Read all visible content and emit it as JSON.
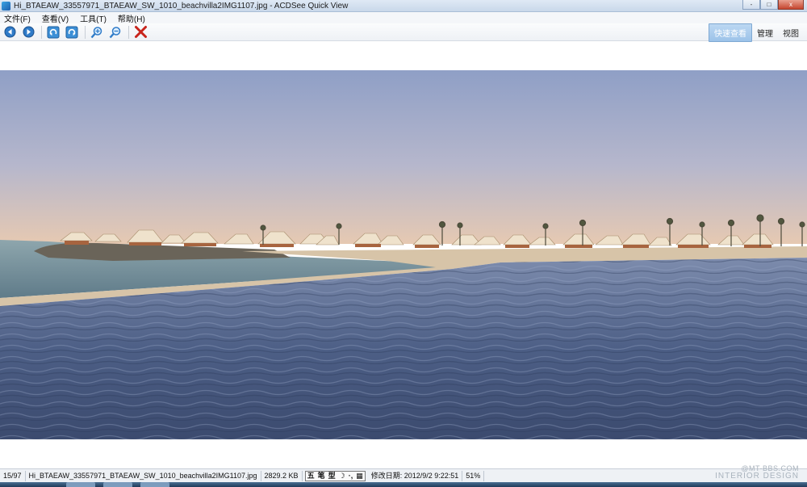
{
  "window": {
    "title": "Hi_BTAEAW_33557971_BTAEAW_SW_1010_beachvilla2IMG1107.jpg - ACDSee Quick View",
    "controls": [
      "-",
      "□",
      "x"
    ]
  },
  "menu": {
    "items": [
      "文件(F)",
      "查看(V)",
      "工具(T)",
      "帮助(H)"
    ]
  },
  "toolbar": {
    "buttons": [
      "back-icon",
      "forward-icon",
      "rotate-left-icon",
      "rotate-right-icon",
      "zoom-in-icon",
      "zoom-out-icon",
      "delete-icon"
    ],
    "tabs": [
      "快速查看",
      "管理",
      "视图"
    ]
  },
  "status": {
    "position": "15/97",
    "filename": "Hi_BTAEAW_33557971_BTAEAW_SW_1010_beachvilla2IMG1107.jpg",
    "size": "2829.2 KB",
    "ime_chars": [
      "五",
      "笔",
      "型"
    ],
    "modified": "修改日期: 2012/9/2 9:22:51",
    "zoom": "51%"
  },
  "watermark": {
    "line1": "@MT-BBS.COM",
    "line2": "INTERIOR DESIGN"
  },
  "colors": {
    "accent": "#9cc3e9",
    "delete": "#c8241b",
    "nav": "#2f7bc8"
  }
}
